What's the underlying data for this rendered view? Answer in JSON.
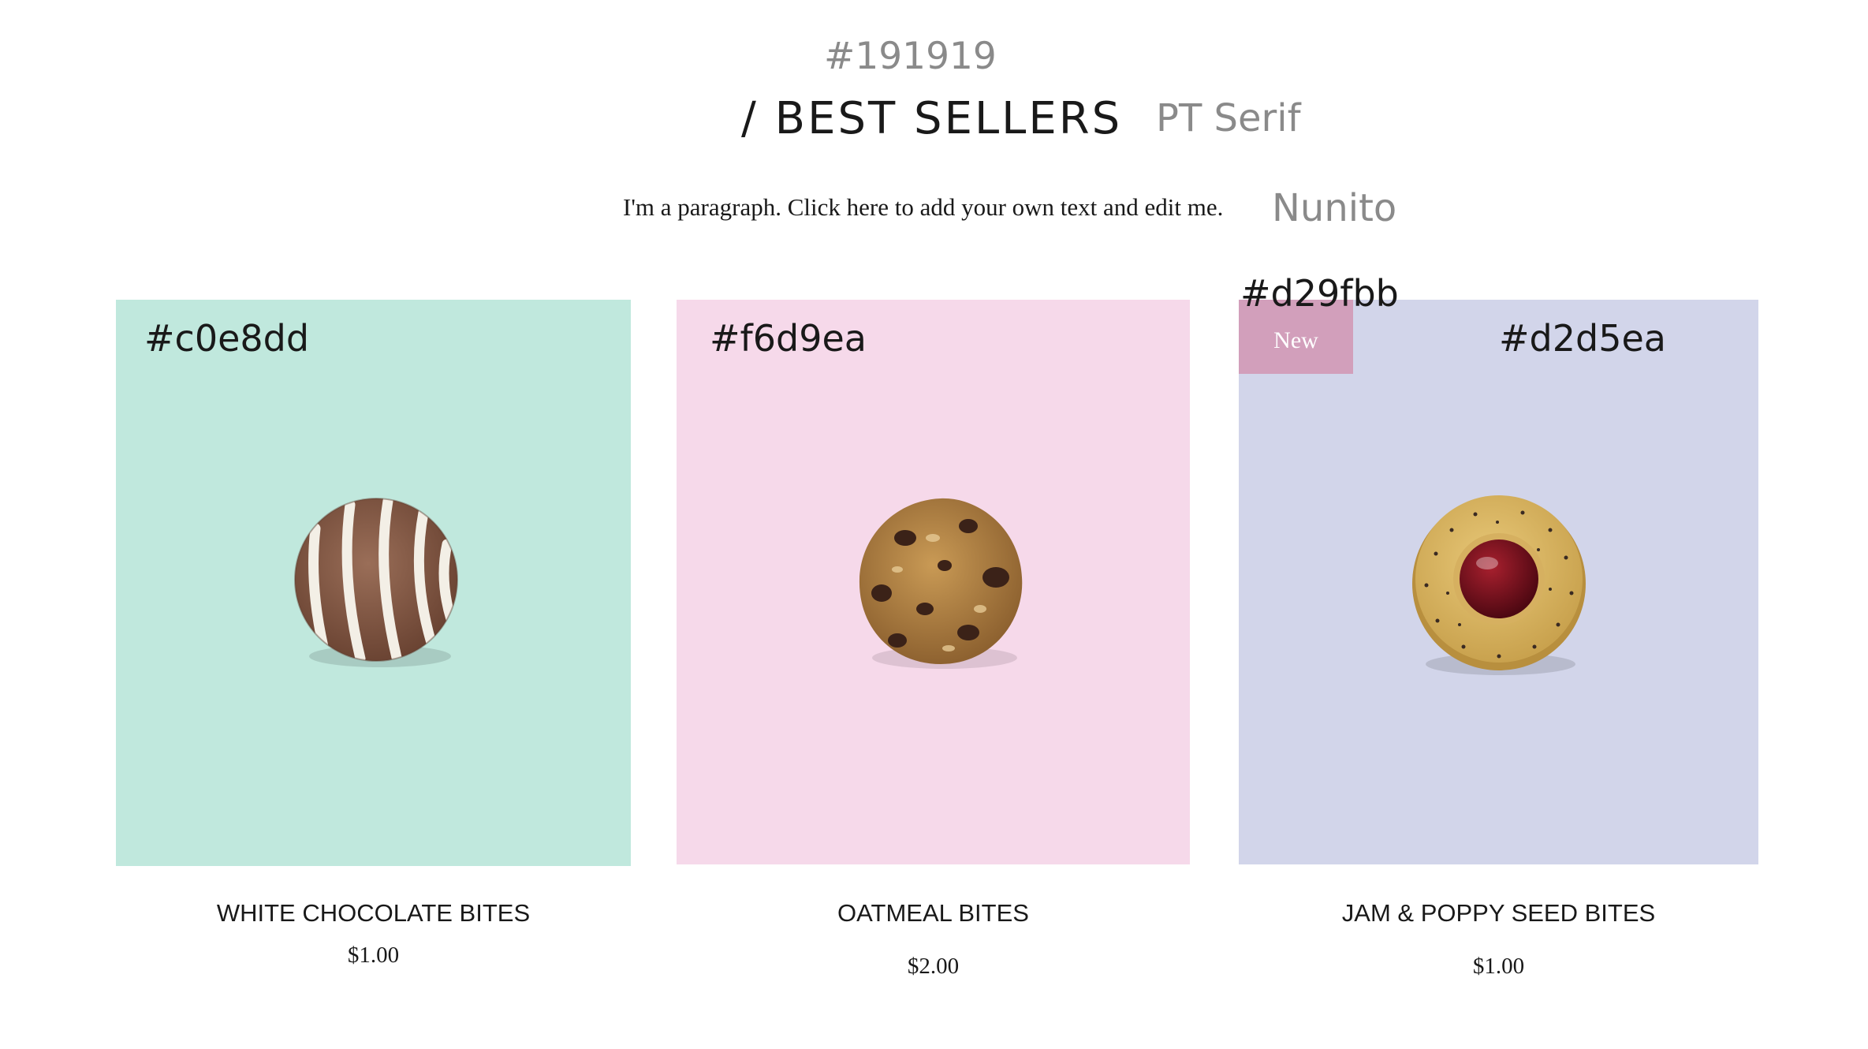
{
  "header": {
    "title_color_note": "#191919",
    "title": "/ BEST SELLERS",
    "title_font_note": "PT Serif",
    "paragraph": "I'm a paragraph. Click here to add your own text and edit me.",
    "paragraph_font_note": "Nunito"
  },
  "badge": {
    "color_note": "#d29fbb",
    "label": "New",
    "color": "#d29fbb"
  },
  "products": [
    {
      "name": "WHITE CHOCOLATE BITES",
      "price": "$1.00",
      "bg_color_note": "#c0e8dd",
      "bg_color": "#c0e8dd",
      "image": "white-chocolate-striped-cookie"
    },
    {
      "name": "OATMEAL BITES",
      "price": "$2.00",
      "bg_color_note": "#f6d9ea",
      "bg_color": "#f6d9ea",
      "image": "oatmeal-raisin-cookie"
    },
    {
      "name": "JAM & POPPY SEED BITES",
      "price": "$1.00",
      "bg_color_note": "#d2d5ea",
      "bg_color": "#d2d5ea",
      "image": "jam-poppy-seed-cookie"
    }
  ]
}
